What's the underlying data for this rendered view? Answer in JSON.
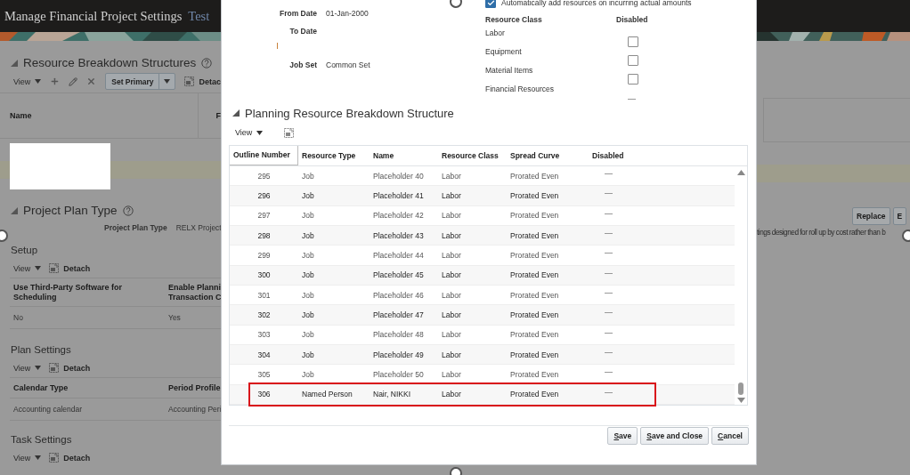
{
  "page": {
    "header": {
      "title": "Manage Financial Project Settings",
      "context": "Test"
    },
    "resource_breakdown_structures": {
      "title": "Resource Breakdown Structures",
      "toolbar": {
        "view": "View",
        "set_primary": "Set Primary",
        "detach": "Detac"
      },
      "columns": [
        "Name",
        "F"
      ]
    },
    "project_plan_type": {
      "title": "Project Plan Type",
      "field_label": "Project Plan Type",
      "field_value": "RELX Project",
      "buttons": [
        "Replace",
        "E"
      ],
      "description": "tings designed for roll up by cost rather than b"
    },
    "sections": [
      {
        "title": "Setup",
        "toolbar": {
          "view": "View",
          "detach": "Detach"
        },
        "columns": [
          "Use Third-Party Software for\nScheduling",
          "Enable Planni\nTransaction C"
        ],
        "rows": [
          [
            "No",
            "Yes"
          ]
        ]
      },
      {
        "title": "Plan Settings",
        "toolbar": {
          "view": "View",
          "detach": "Detach"
        },
        "columns": [
          "Calendar Type",
          "Period Profile"
        ],
        "rows": [
          [
            "Accounting calendar",
            "Accounting Peri"
          ]
        ]
      },
      {
        "title": "Task Settings",
        "toolbar": {
          "view": "View",
          "detach": "Detach"
        }
      }
    ]
  },
  "dialog": {
    "auto_add": {
      "label": "Automatically add resources on incurring actual amounts",
      "checked": true
    },
    "fields": [
      {
        "label": "From Date",
        "value": "01-Jan-2000"
      },
      {
        "label": "To Date"
      },
      {
        "label": "Job Set",
        "value": "Common Set"
      }
    ],
    "resource_classes": {
      "columns": [
        "Resource Class",
        "Disabled"
      ],
      "items": [
        {
          "label": "Labor",
          "kind": "checkbox",
          "checked": false
        },
        {
          "label": "Equipment",
          "kind": "checkbox",
          "checked": false
        },
        {
          "label": "Material Items",
          "kind": "checkbox",
          "checked": false
        },
        {
          "label": "Financial Resources",
          "kind": "readonly",
          "checked": false
        }
      ]
    },
    "planning_rbs": {
      "title": "Planning Resource Breakdown Structure",
      "toolbar": {
        "view": "View"
      },
      "columns": [
        "Outline Number",
        "Resource Type",
        "Name",
        "Resource Class",
        "Spread Curve",
        "Disabled"
      ],
      "rows": [
        {
          "outline": "295",
          "type": "Job",
          "name": "Placeholder 40",
          "class": "Labor",
          "curve": "Prorated Even",
          "disabled": false,
          "highlighted": false
        },
        {
          "outline": "296",
          "type": "Job",
          "name": "Placeholder 41",
          "class": "Labor",
          "curve": "Prorated Even",
          "disabled": false,
          "highlighted": false
        },
        {
          "outline": "297",
          "type": "Job",
          "name": "Placeholder 42",
          "class": "Labor",
          "curve": "Prorated Even",
          "disabled": false,
          "highlighted": false
        },
        {
          "outline": "298",
          "type": "Job",
          "name": "Placeholder 43",
          "class": "Labor",
          "curve": "Prorated Even",
          "disabled": false,
          "highlighted": false
        },
        {
          "outline": "299",
          "type": "Job",
          "name": "Placeholder 44",
          "class": "Labor",
          "curve": "Prorated Even",
          "disabled": false,
          "highlighted": false
        },
        {
          "outline": "300",
          "type": "Job",
          "name": "Placeholder 45",
          "class": "Labor",
          "curve": "Prorated Even",
          "disabled": false,
          "highlighted": false
        },
        {
          "outline": "301",
          "type": "Job",
          "name": "Placeholder 46",
          "class": "Labor",
          "curve": "Prorated Even",
          "disabled": false,
          "highlighted": false
        },
        {
          "outline": "302",
          "type": "Job",
          "name": "Placeholder 47",
          "class": "Labor",
          "curve": "Prorated Even",
          "disabled": false,
          "highlighted": false
        },
        {
          "outline": "303",
          "type": "Job",
          "name": "Placeholder 48",
          "class": "Labor",
          "curve": "Prorated Even",
          "disabled": false,
          "highlighted": false
        },
        {
          "outline": "304",
          "type": "Job",
          "name": "Placeholder 49",
          "class": "Labor",
          "curve": "Prorated Even",
          "disabled": false,
          "highlighted": false
        },
        {
          "outline": "305",
          "type": "Job",
          "name": "Placeholder 50",
          "class": "Labor",
          "curve": "Prorated Even",
          "disabled": false,
          "highlighted": false
        },
        {
          "outline": "306",
          "type": "Named Person",
          "name": "Nair, NIKKI",
          "class": "Labor",
          "curve": "Prorated Even",
          "disabled": false,
          "highlighted": true
        }
      ]
    },
    "buttons": [
      "Save",
      "Save and Close",
      "Cancel"
    ]
  }
}
